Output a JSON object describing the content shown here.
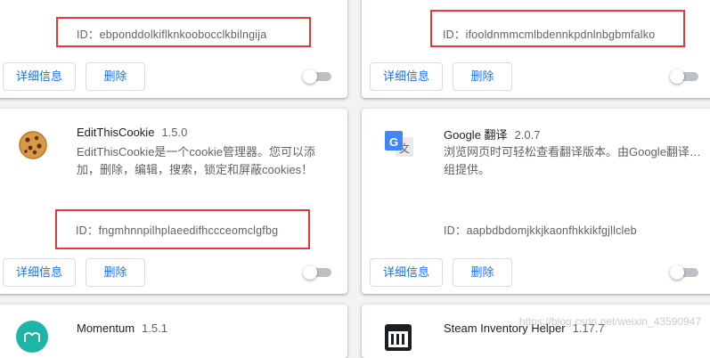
{
  "buttons": {
    "details": "详细信息",
    "remove": "删除"
  },
  "id_prefix": "ID：",
  "cards": {
    "top_left": {
      "id": "ebponddolkiflknkoobocclkbilngija"
    },
    "top_right": {
      "id": "ifooldnmmcmlbdennkpdnlnbgbmfalko"
    },
    "editthiscookie": {
      "name": "EditThisCookie",
      "version": "1.5.0",
      "desc_line1": "EditThisCookie是一个cookie管理器。您可以添",
      "desc_line2": "加，删除，编辑，搜索，锁定和屏蔽cookies！",
      "id": "fngmhnnpilhplaeedifhccceomclgfbg"
    },
    "google_translate": {
      "name": "Google 翻译",
      "version": "2.0.7",
      "desc_line1": "浏览网页时可轻松查看翻译版本。由Google翻译…",
      "desc_line2": "组提供。",
      "id": "aapbdbdomjkkjkaonfhkkikfgjllcleb"
    },
    "momentum": {
      "name": "Momentum",
      "version": "1.5.1"
    },
    "steam": {
      "name": "Steam Inventory Helper",
      "version": "1.17.7"
    }
  },
  "watermark": "https://blog.csdn.net/weixin_43590947",
  "colors": {
    "accent": "#1a73e8",
    "highlight": "#e53935",
    "background": "#f1f3f4"
  }
}
